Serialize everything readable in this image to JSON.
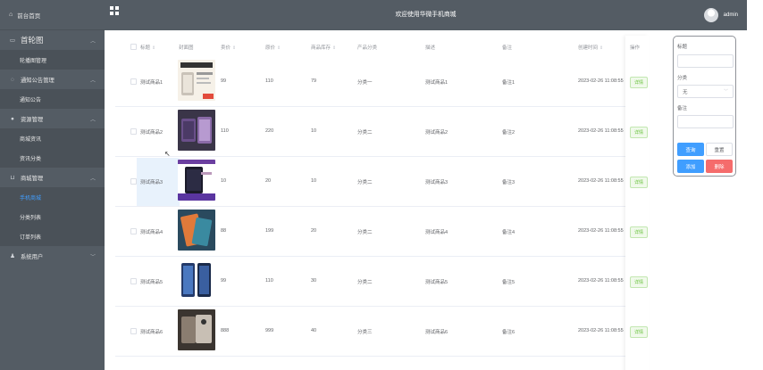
{
  "sidebar": {
    "brand": {
      "icon": "home-icon",
      "label": "前台首页"
    },
    "groups": [
      {
        "label": "首轮图",
        "icon": "image-icon",
        "big": true
      },
      {
        "sub": "轮播图管理"
      },
      {
        "label": "通知公告管理",
        "icon": "bell-icon"
      },
      {
        "sub": "通知公告"
      },
      {
        "label": "资源管理",
        "icon": "location-icon"
      },
      {
        "sub": "商城资讯"
      },
      {
        "sub": "资讯分类"
      },
      {
        "label": "商城管理",
        "icon": "cart-icon"
      },
      {
        "sub": "手机商城",
        "active": true
      },
      {
        "sub": "分类列表"
      },
      {
        "sub": "订单列表"
      },
      {
        "label": "系统用户",
        "icon": "user-icon"
      }
    ]
  },
  "topbar": {
    "title": "欢迎使用华微手机商城",
    "user": "admin"
  },
  "table": {
    "columns": [
      "标题",
      "封面图",
      "卖价",
      "原价",
      "商品库存",
      "产品分类",
      "描述",
      "备注",
      "创建时间",
      "操作"
    ],
    "sortable": [
      true,
      false,
      true,
      true,
      true,
      false,
      false,
      false,
      true,
      false
    ],
    "detail_label": "详情",
    "rows": [
      {
        "title": "测试商品1",
        "price": "99",
        "orig": "110",
        "stock": "79",
        "cat": "分类一",
        "desc": "测试商品1",
        "note": "备注1",
        "time": "2023-02-26 11:08:55"
      },
      {
        "title": "测试商品2",
        "price": "110",
        "orig": "220",
        "stock": "10",
        "cat": "分类二",
        "desc": "测试商品2",
        "note": "备注2",
        "time": "2023-02-26 11:08:55"
      },
      {
        "title": "测试商品3",
        "price": "10",
        "orig": "20",
        "stock": "10",
        "cat": "分类二",
        "desc": "测试商品3",
        "note": "备注3",
        "time": "2023-02-26 11:08:55"
      },
      {
        "title": "测试商品4",
        "price": "88",
        "orig": "199",
        "stock": "20",
        "cat": "分类二",
        "desc": "测试商品4",
        "note": "备注4",
        "time": "2023-02-26 11:08:55"
      },
      {
        "title": "测试商品5",
        "price": "99",
        "orig": "110",
        "stock": "30",
        "cat": "分类二",
        "desc": "测试商品5",
        "note": "备注5",
        "time": "2023-02-26 11:08:55"
      },
      {
        "title": "测试商品6",
        "price": "888",
        "orig": "999",
        "stock": "40",
        "cat": "分类三",
        "desc": "测试商品6",
        "note": "备注6",
        "time": "2023-02-26 11:08:55"
      }
    ]
  },
  "panel": {
    "title_label": "标题",
    "title_value": "",
    "cat_label": "分类",
    "cat_value": "无",
    "note_label": "备注",
    "note_value": "",
    "query": "查询",
    "reset": "重置",
    "add": "添加",
    "delete": "删除"
  }
}
